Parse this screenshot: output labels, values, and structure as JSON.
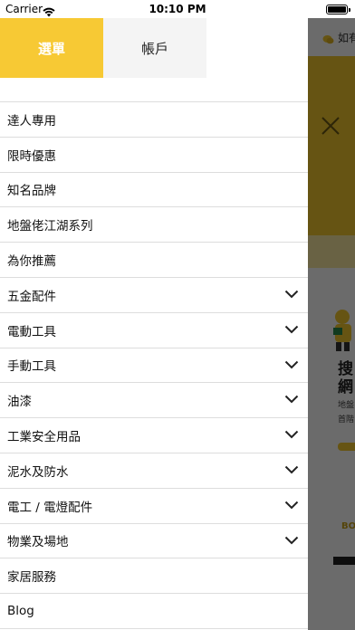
{
  "status_bar": {
    "carrier": "Carrier",
    "time": "10:10 PM"
  },
  "drawer": {
    "tabs": [
      {
        "label": "選單",
        "active": true
      },
      {
        "label": "帳戶",
        "active": false
      }
    ],
    "items": [
      {
        "label": "達人專用",
        "has_chevron": false
      },
      {
        "label": "限時優惠",
        "has_chevron": false
      },
      {
        "label": "知名品牌",
        "has_chevron": false
      },
      {
        "label": "地盤佬江湖系列",
        "has_chevron": false
      },
      {
        "label": "為你推薦",
        "has_chevron": false
      },
      {
        "label": "五金配件",
        "has_chevron": true
      },
      {
        "label": "電動工具",
        "has_chevron": true
      },
      {
        "label": "手動工具",
        "has_chevron": true
      },
      {
        "label": "油漆",
        "has_chevron": true
      },
      {
        "label": "工業安全用品",
        "has_chevron": true
      },
      {
        "label": "泥水及防水",
        "has_chevron": true
      },
      {
        "label": "電工 / 電燈配件",
        "has_chevron": true
      },
      {
        "label": "物業及場地",
        "has_chevron": true
      },
      {
        "label": "家居服務",
        "has_chevron": false
      },
      {
        "label": "Blog",
        "has_chevron": false
      }
    ]
  },
  "background_page": {
    "top_text": "如有",
    "headline_1": "搜",
    "headline_2": "網",
    "subtext_1": "地盤",
    "subtext_2": "首階",
    "brand": "BO"
  },
  "colors": {
    "accent": "#f7c934",
    "dim_overlay": "rgba(0,0,0,0.58)",
    "divider": "#dddddd"
  }
}
